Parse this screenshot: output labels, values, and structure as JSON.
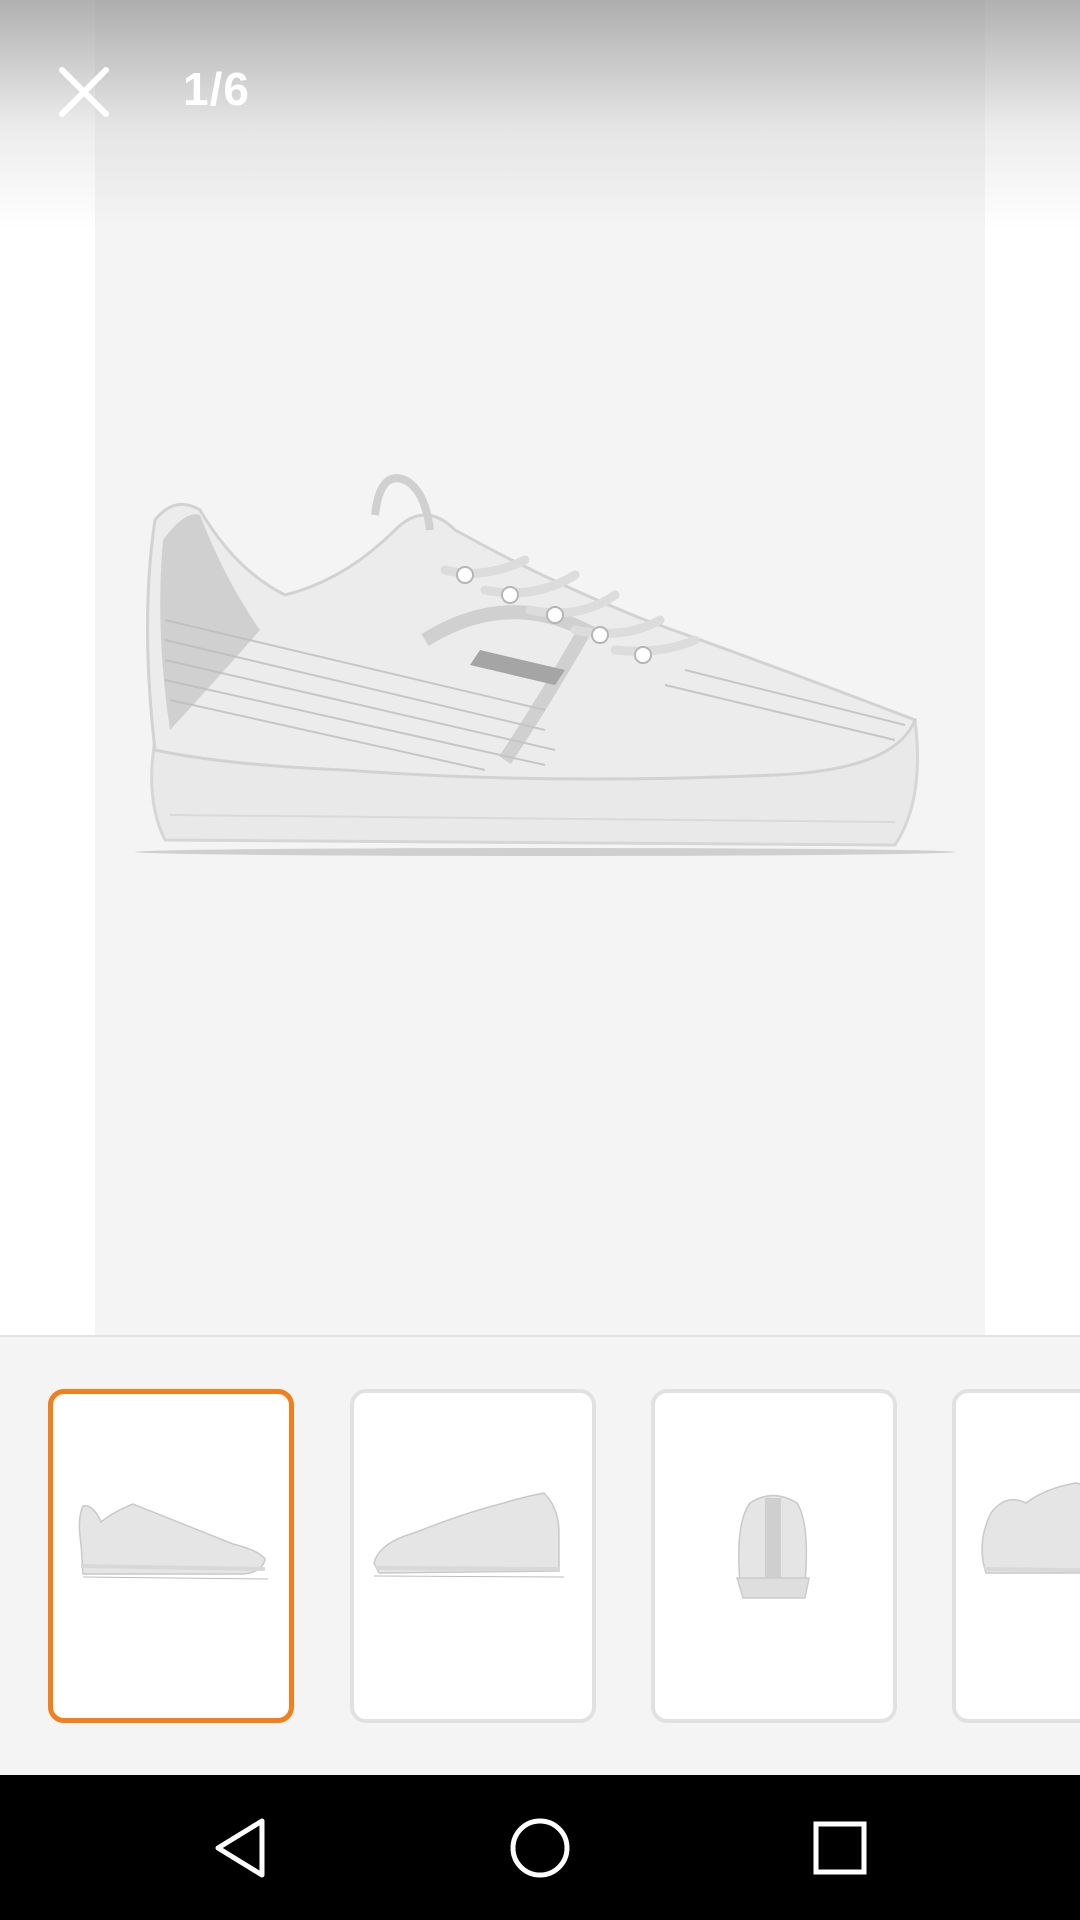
{
  "viewer": {
    "counter": "1/6",
    "close_icon": "close-icon",
    "current_index": 1,
    "total_images": 6
  },
  "thumbnails": [
    {
      "view": "lateral-side",
      "selected": true
    },
    {
      "view": "medial-side",
      "selected": false
    },
    {
      "view": "rear",
      "selected": false
    },
    {
      "view": "three-quarter",
      "selected": false
    }
  ],
  "nav": {
    "back_icon": "back-triangle-icon",
    "home_icon": "home-circle-icon",
    "recents_icon": "recents-square-icon"
  },
  "colors": {
    "selected_border": "#f07f1c",
    "thumb_border": "#e1e1e1",
    "photo_background": "#f4f4f4",
    "nav_background": "#000000"
  }
}
